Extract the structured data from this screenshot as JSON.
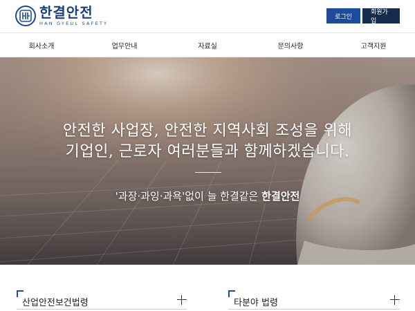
{
  "header": {
    "logo_title": "한결안전",
    "logo_subtitle": "HAN GYEUL SAFETY",
    "login_label": "로그인",
    "join_label": "회원가입"
  },
  "nav": {
    "items": [
      {
        "label": "회사소개"
      },
      {
        "label": "업무안내"
      },
      {
        "label": "자료실"
      },
      {
        "label": "문의사항"
      },
      {
        "label": "고객지원"
      }
    ]
  },
  "hero": {
    "line1": "안전한 사업장, 안전한 지역사회 조성을 위해",
    "line2": "기업인, 근로자 여러분들과 함께하겠습니다.",
    "sub_prefix": "'과장·과잉·과욕'없이 늘 한결같은 ",
    "sub_bold": "한결안전"
  },
  "sections": {
    "left_title": "산업안전보건법령",
    "right_title": "타분야 법령"
  },
  "colors": {
    "brand": "#1b3f7a",
    "login_bg": "#1e4c9c",
    "join_bg": "#162c4e"
  }
}
